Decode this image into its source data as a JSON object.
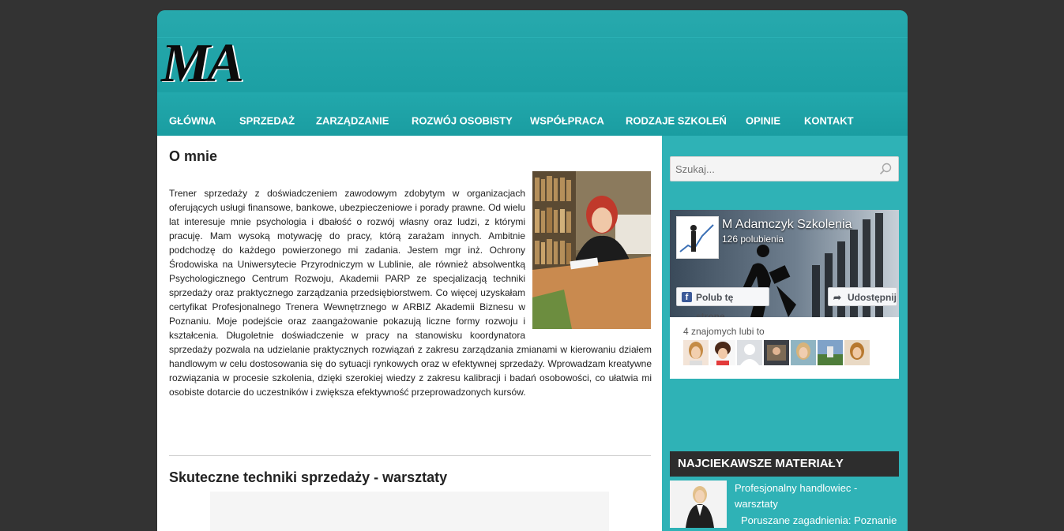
{
  "site": {
    "logo_text": "MA"
  },
  "nav": {
    "items": [
      {
        "label": "GŁÓWNA"
      },
      {
        "label": "SPRZEDAŻ"
      },
      {
        "label": "ZARZĄDZANIE"
      },
      {
        "label": "ROZWÓJ OSOBISTY"
      },
      {
        "label": "WSPÓŁPRACA"
      },
      {
        "label": "RODZAJE SZKOLEŃ"
      },
      {
        "label": "OPINIE"
      },
      {
        "label": "KONTAKT"
      }
    ]
  },
  "main": {
    "about_title": "O mnie",
    "about_text": "Trener sprzedaży z doświadczeniem zawodowym zdobytym w organizacjach oferujących usługi finansowe, bankowe, ubezpieczeniowe i porady prawne. Od wielu lat interesuje mnie psychologia i dbałość o rozwój własny oraz ludzi, z którymi pracuję. Mam wysoką motywację do pracy, którą zarażam innych. Ambitnie podchodzę do każdego powierzonego mi zadania. Jestem mgr inż. Ochrony Środowiska na Uniwersytecie Przyrodniczym w Lublinie, ale również absolwentką Psychologicznego Centrum Rozwoju, Akademii PARP ze specjalizacją techniki sprzedaży oraz praktycznego zarządzania przedsiębiorstwem. Co więcej uzyskałam certyfikat Profesjonalnego Trenera Wewnętrznego w ARBIZ Akademii Biznesu w Poznaniu. Moje podejście oraz zaangażowanie pokazują liczne formy rozwoju i kształcenia. Długoletnie doświadczenie w pracy na stanowisku koordynatora sprzedaży pozwala na udzielanie praktycznych rozwiązań z zakresu zarządzania zmianami w kierowaniu działem handlowym w celu dostosowania się do sytuacji rynkowych oraz w efektywnej sprzedaży. Wprowadzam kreatywne rozwiązania w procesie szkolenia, dzięki szerokiej wiedzy z zakresu kalibracji i badań osobowości, co ułatwia mi osobiste dotarcie do uczestników i zwiększa efektywność przeprowadzonych kursów.",
    "section2_title": "Skuteczne techniki sprzedaży - warsztaty"
  },
  "sidebar": {
    "search_placeholder": "Szukaj...",
    "facebook": {
      "page_name": "M Adamczyk Szkolenia",
      "likes": "126 polubienia",
      "like_button": "Polub tę stronę",
      "share_button": "Udostępnij",
      "friends_label": "4 znajomych lubi to"
    },
    "materials": {
      "header": "NAJCIEKAWSZE MATERIAŁY",
      "item_title": "Profesjonalny handlowiec - warsztaty",
      "item_desc": "Poruszane zagadnienia: Poznanie"
    }
  },
  "colors": {
    "background": "#333333",
    "teal": "#20a7ab",
    "sidebar_teal": "#2fb2b6",
    "facebook_blue": "#3b5998",
    "dark_header": "#2d2d2d"
  }
}
